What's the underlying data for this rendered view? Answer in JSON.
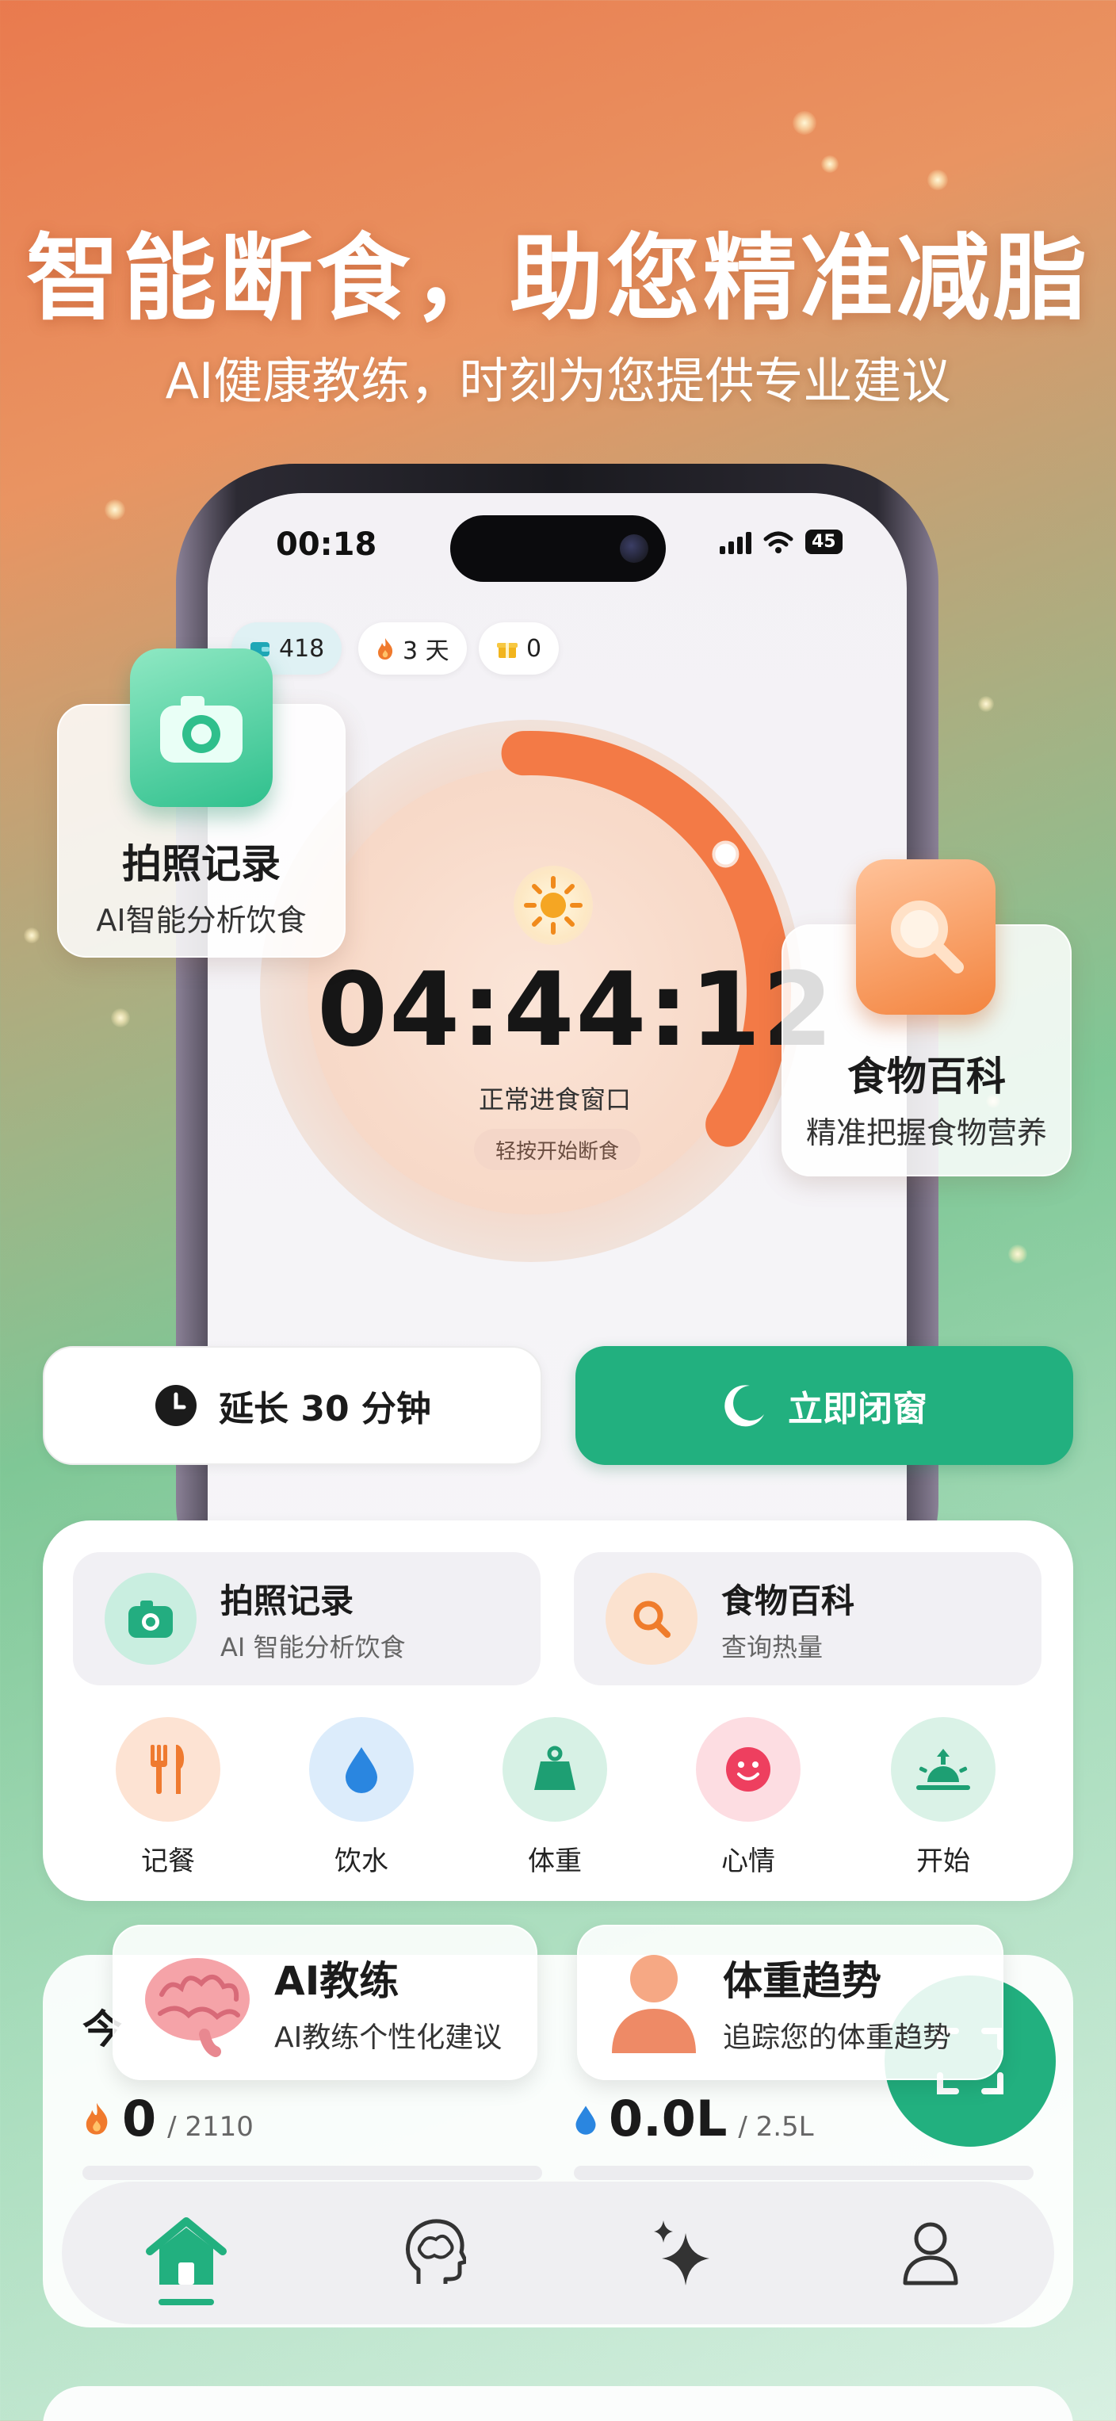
{
  "headline": "智能断食，助您精准减脂",
  "subheadline": "AI健康教练，时刻为您提供专业建议",
  "status_bar": {
    "time": "00:18",
    "battery": "45"
  },
  "badges": [
    {
      "icon": "wallet-icon",
      "value": "418"
    },
    {
      "icon": "flame-icon",
      "value": "3 天"
    },
    {
      "icon": "gift-icon",
      "value": "0"
    }
  ],
  "timer": {
    "time": "04:44:12",
    "window_label": "正常进食窗口",
    "hint": "轻按开始断食",
    "progress": 0.35
  },
  "float_cards": {
    "photo": {
      "title": "拍照记录",
      "subtitle": "AI智能分析饮食"
    },
    "food": {
      "title": "食物百科",
      "subtitle": "精准把握食物营养"
    },
    "coach": {
      "title": "AI教练",
      "subtitle": "AI教练个性化建议"
    },
    "weight": {
      "title": "体重趋势",
      "subtitle": "追踪您的体重趋势"
    }
  },
  "actions": {
    "extend": "延长 30 分钟",
    "close": "立即闭窗"
  },
  "quick_cards": {
    "photo": {
      "title": "拍照记录",
      "subtitle": "AI 智能分析饮食"
    },
    "food": {
      "title": "食物百科",
      "subtitle": "查询热量"
    }
  },
  "quick_actions": [
    {
      "label": "记餐",
      "icon": "utensils-icon"
    },
    {
      "label": "饮水",
      "icon": "water-drop-icon"
    },
    {
      "label": "体重",
      "icon": "scale-icon"
    },
    {
      "label": "心情",
      "icon": "smile-icon"
    },
    {
      "label": "开始",
      "icon": "sunrise-icon"
    }
  ],
  "today": {
    "title_partial": "今",
    "calories": {
      "value": "0",
      "goal": "/ 2110"
    },
    "water": {
      "value": "0.0L",
      "goal": "/ 2.5L"
    }
  },
  "tabs": [
    {
      "name": "home-icon",
      "active": true
    },
    {
      "name": "brain-head-icon",
      "active": false
    },
    {
      "name": "sparkle-icon",
      "active": false
    },
    {
      "name": "profile-icon",
      "active": false
    }
  ],
  "colors": {
    "accent_green": "#22b07f",
    "accent_orange": "#f07a45"
  }
}
